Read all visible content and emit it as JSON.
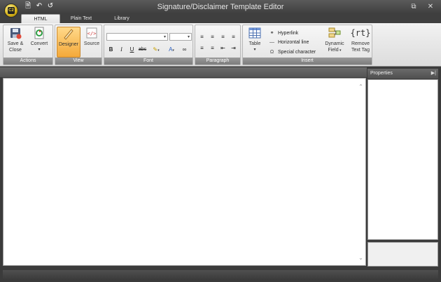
{
  "window": {
    "title": "Signature/Disclaimer Template Editor",
    "orb_text": "C2"
  },
  "qat": {
    "new_icon": "new-document-icon",
    "undo_icon": "undo-icon",
    "redo_icon": "redo-icon"
  },
  "window_controls": {
    "restore_icon": "restore-icon",
    "close_icon": "close-icon"
  },
  "tabs": [
    {
      "label": "HTML",
      "active": true
    },
    {
      "label": "Plain Text"
    },
    {
      "label": "Library"
    }
  ],
  "ribbon": {
    "actions": {
      "label": "Actions",
      "save_close_line1": "Save &",
      "save_close_line2": "Close",
      "convert": "Convert"
    },
    "view": {
      "label": "View",
      "designer": "Designer",
      "source": "Source"
    },
    "font": {
      "label": "Font",
      "font_name": "",
      "font_size": "",
      "bold": "B",
      "italic": "I",
      "underline": "U",
      "strike": "abc",
      "font_color": "A"
    },
    "paragraph": {
      "label": "Paragraph"
    },
    "insert": {
      "label": "Insert",
      "table": "Table",
      "hyperlink": "Hyperlink",
      "horizontal_line": "Horizontal line",
      "special_character": "Special character",
      "dynamic_field_line1": "Dynamic",
      "dynamic_field_line2": "Field",
      "remove_text_tag_line1": "Remove",
      "remove_text_tag_line2": "Text Tag",
      "rt_icon_text": "{rt}"
    }
  },
  "properties": {
    "title": "Properties"
  }
}
